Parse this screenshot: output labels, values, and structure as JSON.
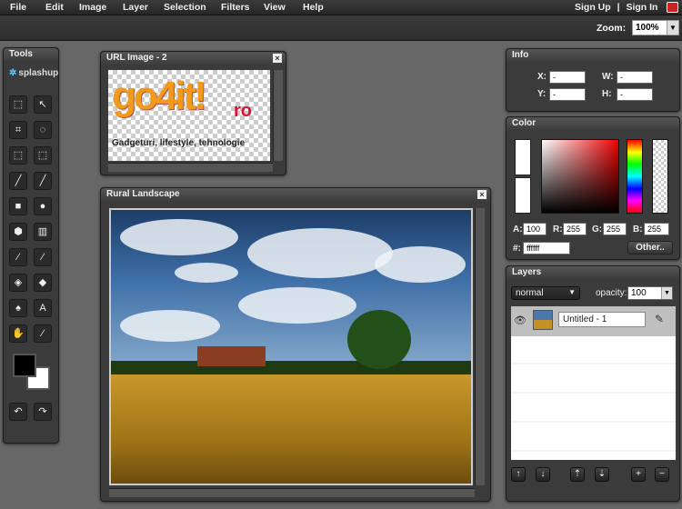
{
  "menubar": {
    "items": [
      "File",
      "Edit",
      "Image",
      "Layer",
      "Selection",
      "Filters",
      "View",
      "Help"
    ],
    "sign_up": "Sign Up",
    "separator": "|",
    "sign_in": "Sign In"
  },
  "toolbar": {
    "zoom_label": "Zoom:",
    "zoom_value": "100%"
  },
  "tools": {
    "title": "Tools",
    "logo": "splashup",
    "buttons": [
      "marquee-rect",
      "move",
      "crop",
      "lasso",
      "marquee-ellipse",
      "magic-select",
      "pencil",
      "line",
      "rectangle",
      "ellipse",
      "polygon",
      "gradient",
      "brush",
      "eyedropper",
      "fill",
      "eraser",
      "clone",
      "text",
      "hand",
      "dropper"
    ],
    "foreground": "#000000",
    "background": "#ffffff"
  },
  "url_image": {
    "title": "URL Image - 2",
    "logo_text": "go4it!",
    "logo_suffix": "ro",
    "tagline": "Gadgeturi, lifestyle, tehnologie"
  },
  "rural": {
    "title": "Rural Landscape"
  },
  "info": {
    "title": "Info",
    "x_label": "X:",
    "x_value": "-",
    "y_label": "Y:",
    "y_value": "-",
    "w_label": "W:",
    "w_value": "-",
    "h_label": "H:",
    "h_value": "-"
  },
  "color": {
    "title": "Color",
    "a_label": "A:",
    "a_value": "100",
    "r_label": "R:",
    "r_value": "255",
    "g_label": "G:",
    "g_value": "255",
    "b_label": "B:",
    "b_value": "255",
    "hex_label": "#:",
    "hex_value": "ffffff",
    "other_label": "Other.."
  },
  "layers": {
    "title": "Layers",
    "blend_mode": "normal",
    "opacity_label": "opacity:",
    "opacity_value": "100",
    "layer_name": "Untitled - 1"
  }
}
